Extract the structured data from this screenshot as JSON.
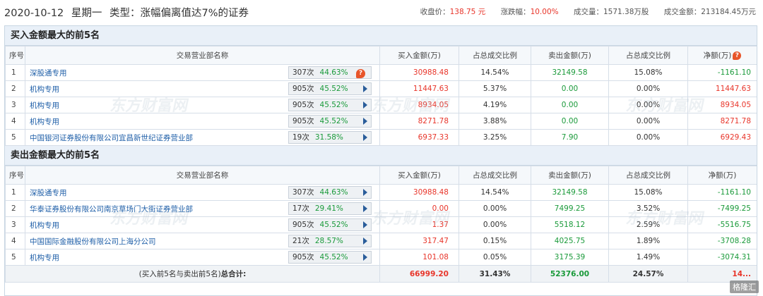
{
  "header": {
    "date": "2020-10-12",
    "weekday": "星期一",
    "type_label": "类型：涨幅偏离值达7%的证券",
    "close_label": "收盘价：",
    "close_value": "138.75",
    "close_unit": "元",
    "change_label": "涨跌幅：",
    "change_value": "10.00%",
    "volume_label": "成交量：",
    "volume_value": "1571.38万股",
    "amount_label": "成交金额：",
    "amount_value": "213184.45万元"
  },
  "columns": {
    "seq": "序号",
    "name": "交易营业部名称",
    "buy": "买入金额(万)",
    "buy_ratio": "占总成交比例",
    "sell": "卖出金额(万)",
    "sell_ratio": "占总成交比例",
    "net": "净额(万)"
  },
  "buy_section": {
    "title": "买入金额最大的前5名",
    "rows": [
      {
        "seq": "1",
        "name": "深股通专用",
        "count": "307次",
        "rate": "44.63%",
        "buy": "30988.48",
        "buy_ratio": "14.54%",
        "sell": "32149.58",
        "sell_ratio": "15.08%",
        "net": "-1161.10",
        "net_sign": "neg",
        "badge": "?"
      },
      {
        "seq": "2",
        "name": "机构专用",
        "count": "905次",
        "rate": "45.52%",
        "buy": "11447.63",
        "buy_ratio": "5.37%",
        "sell": "0.00",
        "sell_ratio": "0.00%",
        "net": "11447.63",
        "net_sign": "pos"
      },
      {
        "seq": "3",
        "name": "机构专用",
        "count": "905次",
        "rate": "45.52%",
        "buy": "8934.05",
        "buy_ratio": "4.19%",
        "sell": "0.00",
        "sell_ratio": "0.00%",
        "net": "8934.05",
        "net_sign": "pos"
      },
      {
        "seq": "4",
        "name": "机构专用",
        "count": "905次",
        "rate": "45.52%",
        "buy": "8271.78",
        "buy_ratio": "3.88%",
        "sell": "0.00",
        "sell_ratio": "0.00%",
        "net": "8271.78",
        "net_sign": "pos"
      },
      {
        "seq": "5",
        "name": "中国银河证券股份有限公司宜昌新世纪证券营业部",
        "count": "19次",
        "rate": "31.58%",
        "buy": "6937.33",
        "buy_ratio": "3.25%",
        "sell": "7.90",
        "sell_ratio": "0.00%",
        "net": "6929.43",
        "net_sign": "pos"
      }
    ]
  },
  "sell_section": {
    "title": "卖出金额最大的前5名",
    "rows": [
      {
        "seq": "1",
        "name": "深股通专用",
        "count": "307次",
        "rate": "44.63%",
        "buy": "30988.48",
        "buy_ratio": "14.54%",
        "sell": "32149.58",
        "sell_ratio": "15.08%",
        "net": "-1161.10",
        "net_sign": "neg"
      },
      {
        "seq": "2",
        "name": "华泰证券股份有限公司南京草场门大街证券营业部",
        "count": "17次",
        "rate": "29.41%",
        "buy": "0.00",
        "buy_ratio": "0.00%",
        "sell": "7499.25",
        "sell_ratio": "3.52%",
        "net": "-7499.25",
        "net_sign": "neg"
      },
      {
        "seq": "3",
        "name": "机构专用",
        "count": "905次",
        "rate": "45.52%",
        "buy": "1.37",
        "buy_ratio": "0.00%",
        "sell": "5518.12",
        "sell_ratio": "2.59%",
        "net": "-5516.75",
        "net_sign": "neg"
      },
      {
        "seq": "4",
        "name": "中国国际金融股份有限公司上海分公司",
        "count": "21次",
        "rate": "28.57%",
        "buy": "317.47",
        "buy_ratio": "0.15%",
        "sell": "4025.75",
        "sell_ratio": "1.89%",
        "net": "-3708.28",
        "net_sign": "neg"
      },
      {
        "seq": "5",
        "name": "机构专用",
        "count": "905次",
        "rate": "45.52%",
        "buy": "101.08",
        "buy_ratio": "0.05%",
        "sell": "3175.39",
        "sell_ratio": "1.49%",
        "net": "-3074.31",
        "net_sign": "neg"
      }
    ]
  },
  "total": {
    "label_prefix": "(买入前5名与卖出前5名)",
    "label_bold": "总合计:",
    "buy": "66999.20",
    "buy_ratio": "31.43%",
    "sell": "52376.00",
    "sell_ratio": "24.57%",
    "net": "14..."
  },
  "watermark_text": "东方财富网",
  "logo_text": "格隆汇",
  "colors": {
    "red": "#e8352a",
    "green": "#1a9a3a",
    "link": "#1f5fa8",
    "section_bg": "#e9f0f8",
    "border": "#c8d6e3"
  }
}
